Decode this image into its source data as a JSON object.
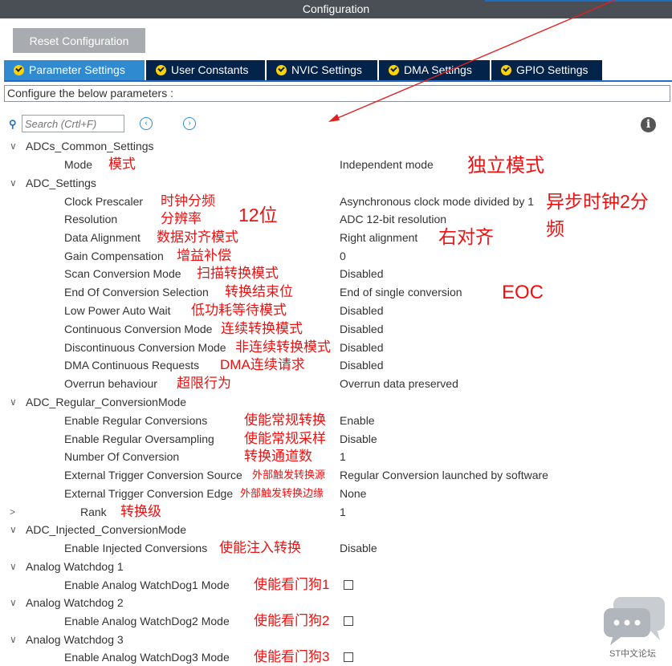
{
  "window": {
    "title": "Configuration"
  },
  "toolbar": {
    "reset_label": "Reset Configuration"
  },
  "tabs": [
    {
      "label": "Parameter Settings",
      "active": true
    },
    {
      "label": "User Constants",
      "active": false
    },
    {
      "label": "NVIC Settings",
      "active": false
    },
    {
      "label": "DMA Settings",
      "active": false
    },
    {
      "label": "GPIO Settings",
      "active": false
    }
  ],
  "configure_text": "Configure the below parameters :",
  "search": {
    "placeholder": "Search (Crtl+F)",
    "icon": "search-icon",
    "prev_icon": "chevron-left-icon",
    "next_icon": "chevron-right-icon"
  },
  "info_icon": "info-icon",
  "groups": {
    "common": "ADCs_Common_Settings",
    "settings": "ADC_Settings",
    "regular": "ADC_Regular_ConversionMode",
    "injected": "ADC_Injected_ConversionMode",
    "wd1": "Analog Watchdog 1",
    "wd2": "Analog Watchdog 2",
    "wd3": "Analog Watchdog 3"
  },
  "params": {
    "mode": {
      "label": "Mode",
      "value": "Independent mode",
      "note": "模式"
    },
    "clock": {
      "label": "Clock Prescaler",
      "value": "Asynchronous clock mode divided by 1",
      "note": "时钟分频"
    },
    "resolution": {
      "label": "Resolution",
      "value": "ADC 12-bit resolution",
      "note": "分辨率"
    },
    "alignment": {
      "label": "Data Alignment",
      "value": "Right alignment",
      "note": "数据对齐模式"
    },
    "gain": {
      "label": "Gain Compensation",
      "value": "0",
      "note": "增益补偿"
    },
    "scan": {
      "label": "Scan Conversion Mode",
      "value": "Disabled",
      "note": "扫描转换模式"
    },
    "eoc": {
      "label": "End Of Conversion Selection",
      "value": "End of single conversion",
      "note": "转换结束位"
    },
    "lowpower": {
      "label": "Low Power Auto Wait",
      "value": "Disabled",
      "note": "低功耗等待模式"
    },
    "continuous": {
      "label": "Continuous Conversion Mode",
      "value": "Disabled",
      "note": "连续转换模式"
    },
    "discontinuous": {
      "label": "Discontinuous Conversion Mode",
      "value": "Disabled",
      "note": "非连续转换模式"
    },
    "dma": {
      "label": "DMA Continuous Requests",
      "value": "Disabled",
      "note": "DMA连续请求"
    },
    "overrun": {
      "label": "Overrun behaviour",
      "value": "Overrun data preserved",
      "note": "超限行为"
    },
    "enable_regular": {
      "label": "Enable Regular Conversions",
      "value": "Enable",
      "note": "使能常规转换"
    },
    "oversampling": {
      "label": "Enable Regular Oversampling",
      "value": "Disable",
      "note": "使能常规采样"
    },
    "num_conv": {
      "label": "Number Of Conversion",
      "value": "1",
      "note": "转换通道数"
    },
    "trig_source": {
      "label": "External Trigger Conversion Source",
      "value": "Regular Conversion launched by software",
      "note": "外部触发转换源"
    },
    "trig_edge": {
      "label": "External Trigger Conversion Edge",
      "value": "None",
      "note": "外部触发转换边缘"
    },
    "rank": {
      "label": "Rank",
      "value": "1",
      "note": "转换级"
    },
    "enable_injected": {
      "label": "Enable Injected Conversions",
      "value": "Disable",
      "note": "使能注入转换"
    },
    "wd1_mode": {
      "label": "Enable Analog WatchDog1 Mode",
      "value": "",
      "note": "使能看门狗1"
    },
    "wd2_mode": {
      "label": "Enable Analog WatchDog2 Mode",
      "value": "",
      "note": "使能看门狗2"
    },
    "wd3_mode": {
      "label": "Enable Analog WatchDog3 Mode",
      "value": "",
      "note": "使能看门狗3"
    }
  },
  "big_annotations": {
    "independent": "独立模式",
    "async_line1": "异步时钟2分",
    "async_line2": "频",
    "bits12": "12位",
    "right_align": "右对齐",
    "eoc": "EOC"
  },
  "watermark": {
    "text": "ST中文论坛",
    "icon": "chat-bubbles-icon"
  },
  "colors": {
    "accent": "#1e6fc4",
    "tab_bg": "#03234b",
    "tab_active": "#2f8ad0",
    "annotation": "#ee1111",
    "titlebar": "#4a4f55"
  }
}
